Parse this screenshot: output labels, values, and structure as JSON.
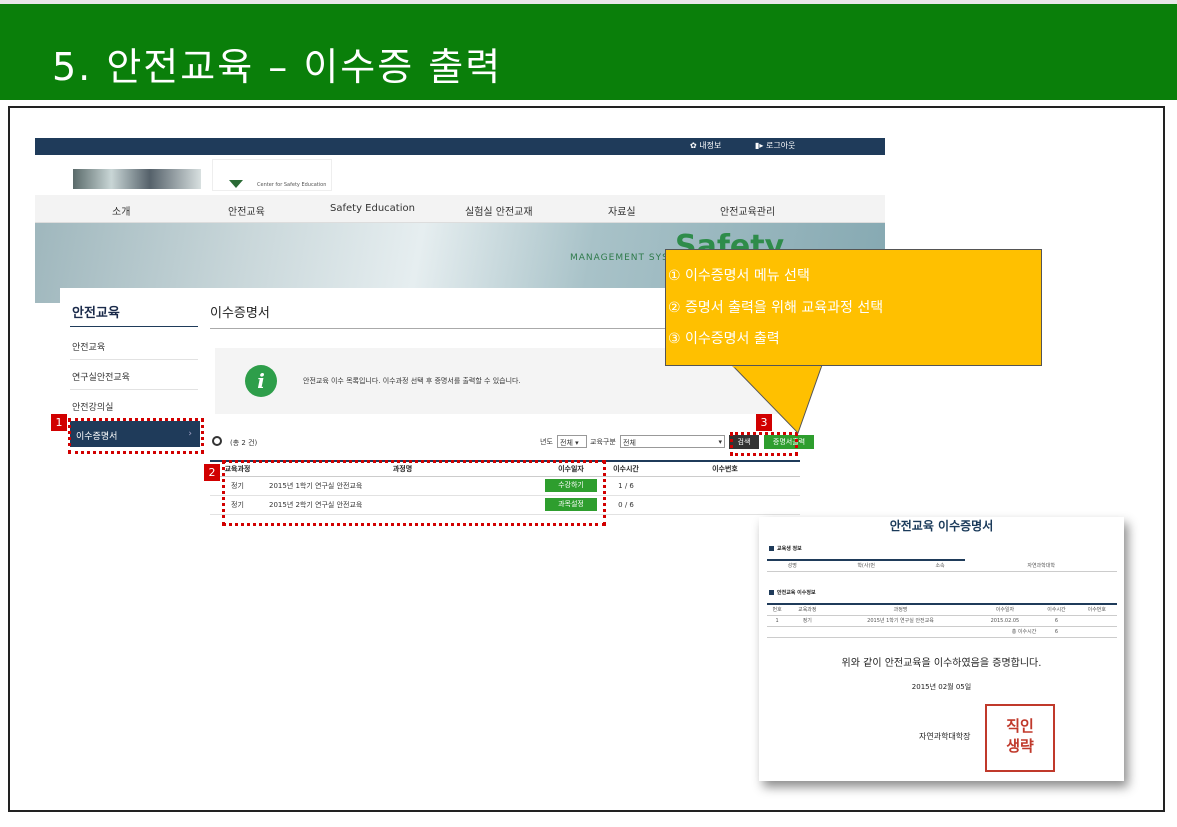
{
  "slide": {
    "title": "5. 안전교육 – 이수증 출력"
  },
  "site": {
    "util": {
      "myinfo": "내정보",
      "logout": "로그아웃"
    },
    "logo_subtitle": "Center for Safety Education",
    "nav": [
      "소개",
      "안전교육",
      "Safety Education",
      "실험실 안전교재",
      "자료실",
      "안전교육관리"
    ],
    "banner": {
      "mgmt": "MANAGEMENT SYST",
      "safety": "Safety"
    },
    "sidebar": {
      "title": "안전교육",
      "items": [
        "안전교육",
        "연구실안전교육",
        "안전강의실"
      ],
      "active": "이수증명서",
      "active_arrow": "›"
    },
    "page_title": "이수증명서",
    "info_text": "안전교육 이수 목록입니다. 이수과정 선택 후 증명서를 출력할 수 있습니다.",
    "search": {
      "count": "(총 2 건)",
      "year_label": "년도",
      "year_value": "전체 ▾",
      "type_label": "교육구분",
      "type_value": "전체",
      "search_button": "검색",
      "print_button": "증명서출력"
    },
    "table": {
      "headers": [
        "교육과정",
        "과정명",
        "이수일자",
        "이수시간",
        "이수번호"
      ],
      "rows": [
        {
          "type": "정기",
          "name": "2015년 1학기 연구실 안전교육",
          "action": "수강하기",
          "time": "1 / 6",
          "no": ""
        },
        {
          "type": "정기",
          "name": "2015년 2학기 연구실 안전교육",
          "action": "과목설정",
          "time": "0 / 6",
          "no": ""
        }
      ]
    }
  },
  "markers": {
    "m1": "1",
    "m2": "2",
    "m3": "3"
  },
  "callout": {
    "line1": "① 이수증명서 메뉴 선택",
    "line2": "② 증명서 출력을 위해 교육과정 선택",
    "line3": "③ 이수증명서 출력"
  },
  "certificate": {
    "title": "안전교육 이수증명서",
    "section1": "교육생 정보",
    "info_row": [
      "성명",
      "",
      "학(사)번",
      "",
      "소속",
      "자연과학대학"
    ],
    "section2": "안전교육 이수정보",
    "headers": [
      "번호",
      "교육과정",
      "과정명",
      "이수일자",
      "이수시간",
      "이수번호"
    ],
    "row": [
      "1",
      "정기",
      "2015년 1학기 연구실 안전교육",
      "2015.02.05",
      "6",
      ""
    ],
    "total_label": "총 이수시간",
    "total_value": "6",
    "statement": "위와 같이 안전교육을 이수하였음을 증명합니다.",
    "date": "2015년 02월 05일",
    "signer": "자연과학대학장",
    "stamp_line1": "직인",
    "stamp_line2": "생략"
  },
  "colors": {
    "title_green": "#0a7f0a",
    "navy": "#1f3b5a",
    "button_green": "#2e9e2e",
    "callout": "#ffc000",
    "highlight_red": "#d10000"
  }
}
